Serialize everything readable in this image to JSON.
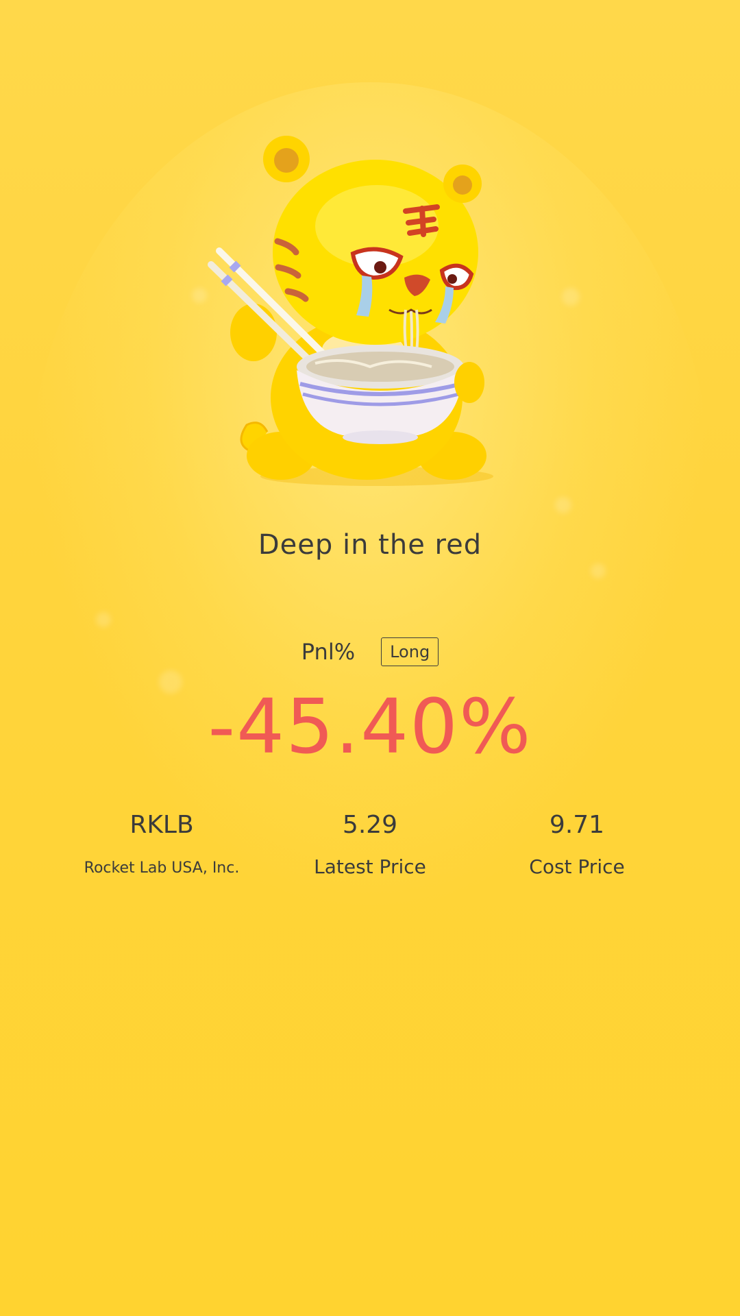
{
  "headline": "Deep in the red",
  "pnl": {
    "label": "Pnl%",
    "direction": "Long",
    "value": "-45.40%"
  },
  "stock": {
    "ticker": "RKLB",
    "name": "Rocket Lab USA, Inc."
  },
  "latest_price": {
    "value": "5.29",
    "label": "Latest Price"
  },
  "cost_price": {
    "value": "9.71",
    "label": "Cost Price"
  },
  "colors": {
    "background": "#ffd43d",
    "loss_red": "#f05a55",
    "text": "#3b3b3b"
  },
  "mascot": {
    "icon": "crying-tiger-eating-noodles-icon"
  }
}
